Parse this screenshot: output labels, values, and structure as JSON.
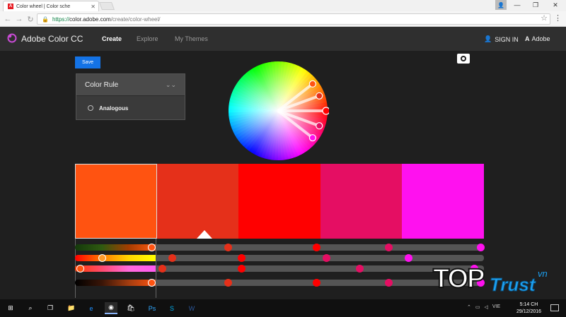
{
  "browser": {
    "tab_title": "Color wheel | Color sche",
    "tab_favicon": "A",
    "url_proto": "https://",
    "url_host": "color.adobe.com",
    "url_path": "/create/color-wheel/"
  },
  "app": {
    "brand": "Adobe Color CC",
    "nav": [
      "Create",
      "Explore",
      "My Themes"
    ],
    "signin": "SIGN IN",
    "adobe": "Adobe"
  },
  "toolbar": {
    "save_label": "Save"
  },
  "color_rule": {
    "header": "Color Rule",
    "selected": "Analogous"
  },
  "swatches": [
    "#FF5311",
    "#E5301A",
    "#FF0000",
    "#E50E63",
    "#FF11EF"
  ],
  "sliders": [
    {
      "gradient": "linear-gradient(to right,#14390b,#2f5a10,#a53c00,#ff5a11)",
      "handle_color": "#ff5311",
      "handle_pos": 0.95,
      "dots": [
        {
          "c": "#e5301a",
          "p": 0.22
        },
        {
          "c": "#ff0000",
          "p": 0.49
        },
        {
          "c": "#e50e63",
          "p": 0.71
        },
        {
          "c": "#ff11ef",
          "p": 0.99
        }
      ]
    },
    {
      "gradient": "linear-gradient(to right,#ff0000,#ff7a00,#ffd500,#ffff00)",
      "handle_color": "#ff9a2a",
      "handle_pos": 0.33,
      "dots": [
        {
          "c": "#e5301a",
          "p": 0.05
        },
        {
          "c": "#ff0000",
          "p": 0.26
        },
        {
          "c": "#e50e63",
          "p": 0.52
        },
        {
          "c": "#ff11ef",
          "p": 0.77
        }
      ]
    },
    {
      "gradient": "linear-gradient(to right,#ff3a00,#ff4a6e,#ff6adc,#ff5af0)",
      "handle_color": "#ff5311",
      "handle_pos": 0.06,
      "dots": [
        {
          "c": "#e5301a",
          "p": 0.02
        },
        {
          "c": "#ff0000",
          "p": 0.26
        },
        {
          "c": "#e50e63",
          "p": 0.62
        },
        {
          "c": "#ff11ef",
          "p": 0.97
        }
      ]
    },
    {
      "gradient": "linear-gradient(to right,#000000,#3a1507,#a33d10,#ff5311)",
      "handle_color": "#ff5311",
      "handle_pos": 0.95,
      "dots": [
        {
          "c": "#e5301a",
          "p": 0.22
        },
        {
          "c": "#ff0000",
          "p": 0.49
        },
        {
          "c": "#e50e63",
          "p": 0.71
        },
        {
          "c": "#ff11ef",
          "p": 0.99
        }
      ]
    }
  ],
  "wheel_handles": [
    {
      "angle": -38,
      "color": "#ff5311"
    },
    {
      "angle": -20,
      "color": "#e5301a"
    },
    {
      "angle": 0,
      "color": "#ff0000"
    },
    {
      "angle": 20,
      "color": "#e50e63"
    },
    {
      "angle": 38,
      "color": "#ff11ef"
    }
  ],
  "watermark": {
    "top": "TOP",
    "trust": "Trust",
    "vn": "vn"
  },
  "taskbar": {
    "lang": "VIE",
    "time": "5:14 CH",
    "date": "29/12/2016"
  }
}
